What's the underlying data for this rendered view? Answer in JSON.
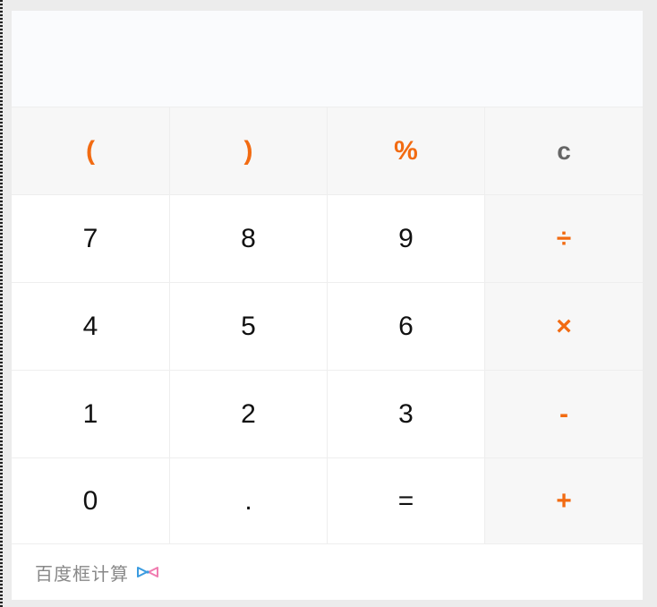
{
  "display": {
    "value": ""
  },
  "keys": [
    {
      "label": "(",
      "name": "open-paren-button"
    },
    {
      "label": ")",
      "name": "close-paren-button"
    },
    {
      "label": "%",
      "name": "percent-button"
    },
    {
      "label": "c",
      "name": "clear-button"
    },
    {
      "label": "7",
      "name": "digit-7-button"
    },
    {
      "label": "8",
      "name": "digit-8-button"
    },
    {
      "label": "9",
      "name": "digit-9-button"
    },
    {
      "label": "÷",
      "name": "divide-button"
    },
    {
      "label": "4",
      "name": "digit-4-button"
    },
    {
      "label": "5",
      "name": "digit-5-button"
    },
    {
      "label": "6",
      "name": "digit-6-button"
    },
    {
      "label": "×",
      "name": "multiply-button"
    },
    {
      "label": "1",
      "name": "digit-1-button"
    },
    {
      "label": "2",
      "name": "digit-2-button"
    },
    {
      "label": "3",
      "name": "digit-3-button"
    },
    {
      "label": "-",
      "name": "subtract-button"
    },
    {
      "label": "0",
      "name": "digit-0-button"
    },
    {
      "label": ".",
      "name": "decimal-button"
    },
    {
      "label": "=",
      "name": "equals-button"
    },
    {
      "label": "+",
      "name": "add-button"
    }
  ],
  "footer": {
    "label": "百度框计算",
    "icon": "bow-icon"
  },
  "colors": {
    "accent": "#f26b12",
    "clear": "#666666",
    "function_bg": "#f7f7f7",
    "display_bg": "#fafbfd"
  }
}
